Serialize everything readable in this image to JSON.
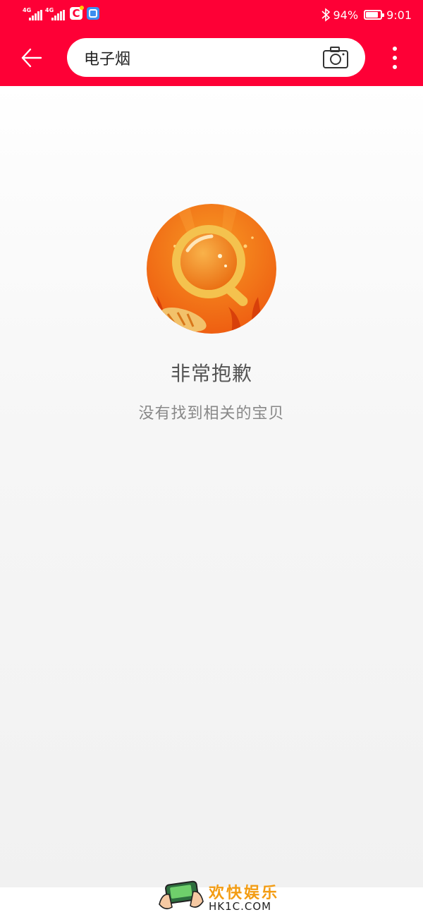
{
  "status_bar": {
    "network_1": "4G",
    "network_2": "4G",
    "app_icon_1": "C",
    "battery_percent": "94%",
    "battery_level": 0.94,
    "time": "9:01"
  },
  "header": {
    "back_icon": "arrow-left-icon",
    "search_value": "电子烟",
    "camera_icon": "camera-icon",
    "more_icon": "more-vertical-icon",
    "brand_color": "#fe0036"
  },
  "empty_state": {
    "illustration": "magnifier-underwater-illustration",
    "title": "非常抱歉",
    "message": "没有找到相关的宝贝"
  },
  "watermark": {
    "name": "欢快娱乐",
    "url": "HK1C.COM"
  }
}
